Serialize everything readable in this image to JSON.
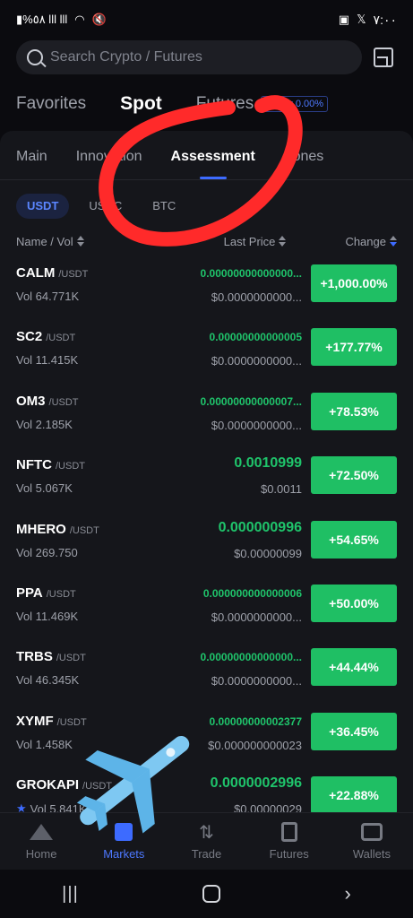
{
  "status_bar": {
    "left": "▮%٥٨  lll  lll",
    "time": "٧:٠٠"
  },
  "search": {
    "placeholder": "Search Crypto / Futures"
  },
  "top_tabs": [
    {
      "label": "Favorites"
    },
    {
      "label": "Spot"
    },
    {
      "label": "Futures"
    }
  ],
  "maker_badge": "Maker 0.00%",
  "sub_tabs": [
    {
      "label": "Main"
    },
    {
      "label": "Innovation"
    },
    {
      "label": "Assessment"
    },
    {
      "label": "Zones"
    }
  ],
  "quote_chips": [
    {
      "label": "USDT"
    },
    {
      "label": "USDC"
    },
    {
      "label": "BTC"
    }
  ],
  "headers": {
    "name_vol": "Name  / Vol",
    "last_price": "Last Price",
    "change": "Change"
  },
  "rows": [
    {
      "symbol": "CALM",
      "quote": "/USDT",
      "vol": "Vol 64.771K",
      "price": "0.00000000000000...",
      "fiat": "$0.0000000000...",
      "change": "+1,000.00%",
      "big": false
    },
    {
      "symbol": "SC2",
      "quote": "/USDT",
      "vol": "Vol 11.415K",
      "price": "0.00000000000005",
      "fiat": "$0.0000000000...",
      "change": "+177.77%",
      "big": false
    },
    {
      "symbol": "OM3",
      "quote": "/USDT",
      "vol": "Vol 2.185K",
      "price": "0.00000000000007...",
      "fiat": "$0.0000000000...",
      "change": "+78.53%",
      "big": false
    },
    {
      "symbol": "NFTC",
      "quote": "/USDT",
      "vol": "Vol 5.067K",
      "price": "0.0010999",
      "fiat": "$0.0011",
      "change": "+72.50%",
      "big": true
    },
    {
      "symbol": "MHERO",
      "quote": "/USDT",
      "vol": "Vol 269.750",
      "price": "0.000000996",
      "fiat": "$0.00000099",
      "change": "+54.65%",
      "big": true
    },
    {
      "symbol": "PPA",
      "quote": "/USDT",
      "vol": "Vol 11.469K",
      "price": "0.000000000000006",
      "fiat": "$0.0000000000...",
      "change": "+50.00%",
      "big": false
    },
    {
      "symbol": "TRBS",
      "quote": "/USDT",
      "vol": "Vol 46.345K",
      "price": "0.00000000000000...",
      "fiat": "$0.0000000000...",
      "change": "+44.44%",
      "big": false
    },
    {
      "symbol": "XYMF",
      "quote": "/USDT",
      "vol": "Vol 1.458K",
      "price": "0.00000000002377",
      "fiat": "$0.000000000023",
      "change": "+36.45%",
      "big": false
    },
    {
      "symbol": "GROKAPI",
      "quote": "/USDT",
      "vol": "Vol 5.841K",
      "price": "0.0000002996",
      "fiat": "$0.00000029",
      "change": "+22.88%",
      "big": true,
      "starred": true
    }
  ],
  "bottom_nav": [
    {
      "label": "Home"
    },
    {
      "label": "Markets"
    },
    {
      "label": "Trade"
    },
    {
      "label": "Futures"
    },
    {
      "label": "Wallets"
    }
  ],
  "colors": {
    "up": "#1fbf64",
    "accent": "#3d6bff",
    "annotation": "#ff2a2a"
  }
}
